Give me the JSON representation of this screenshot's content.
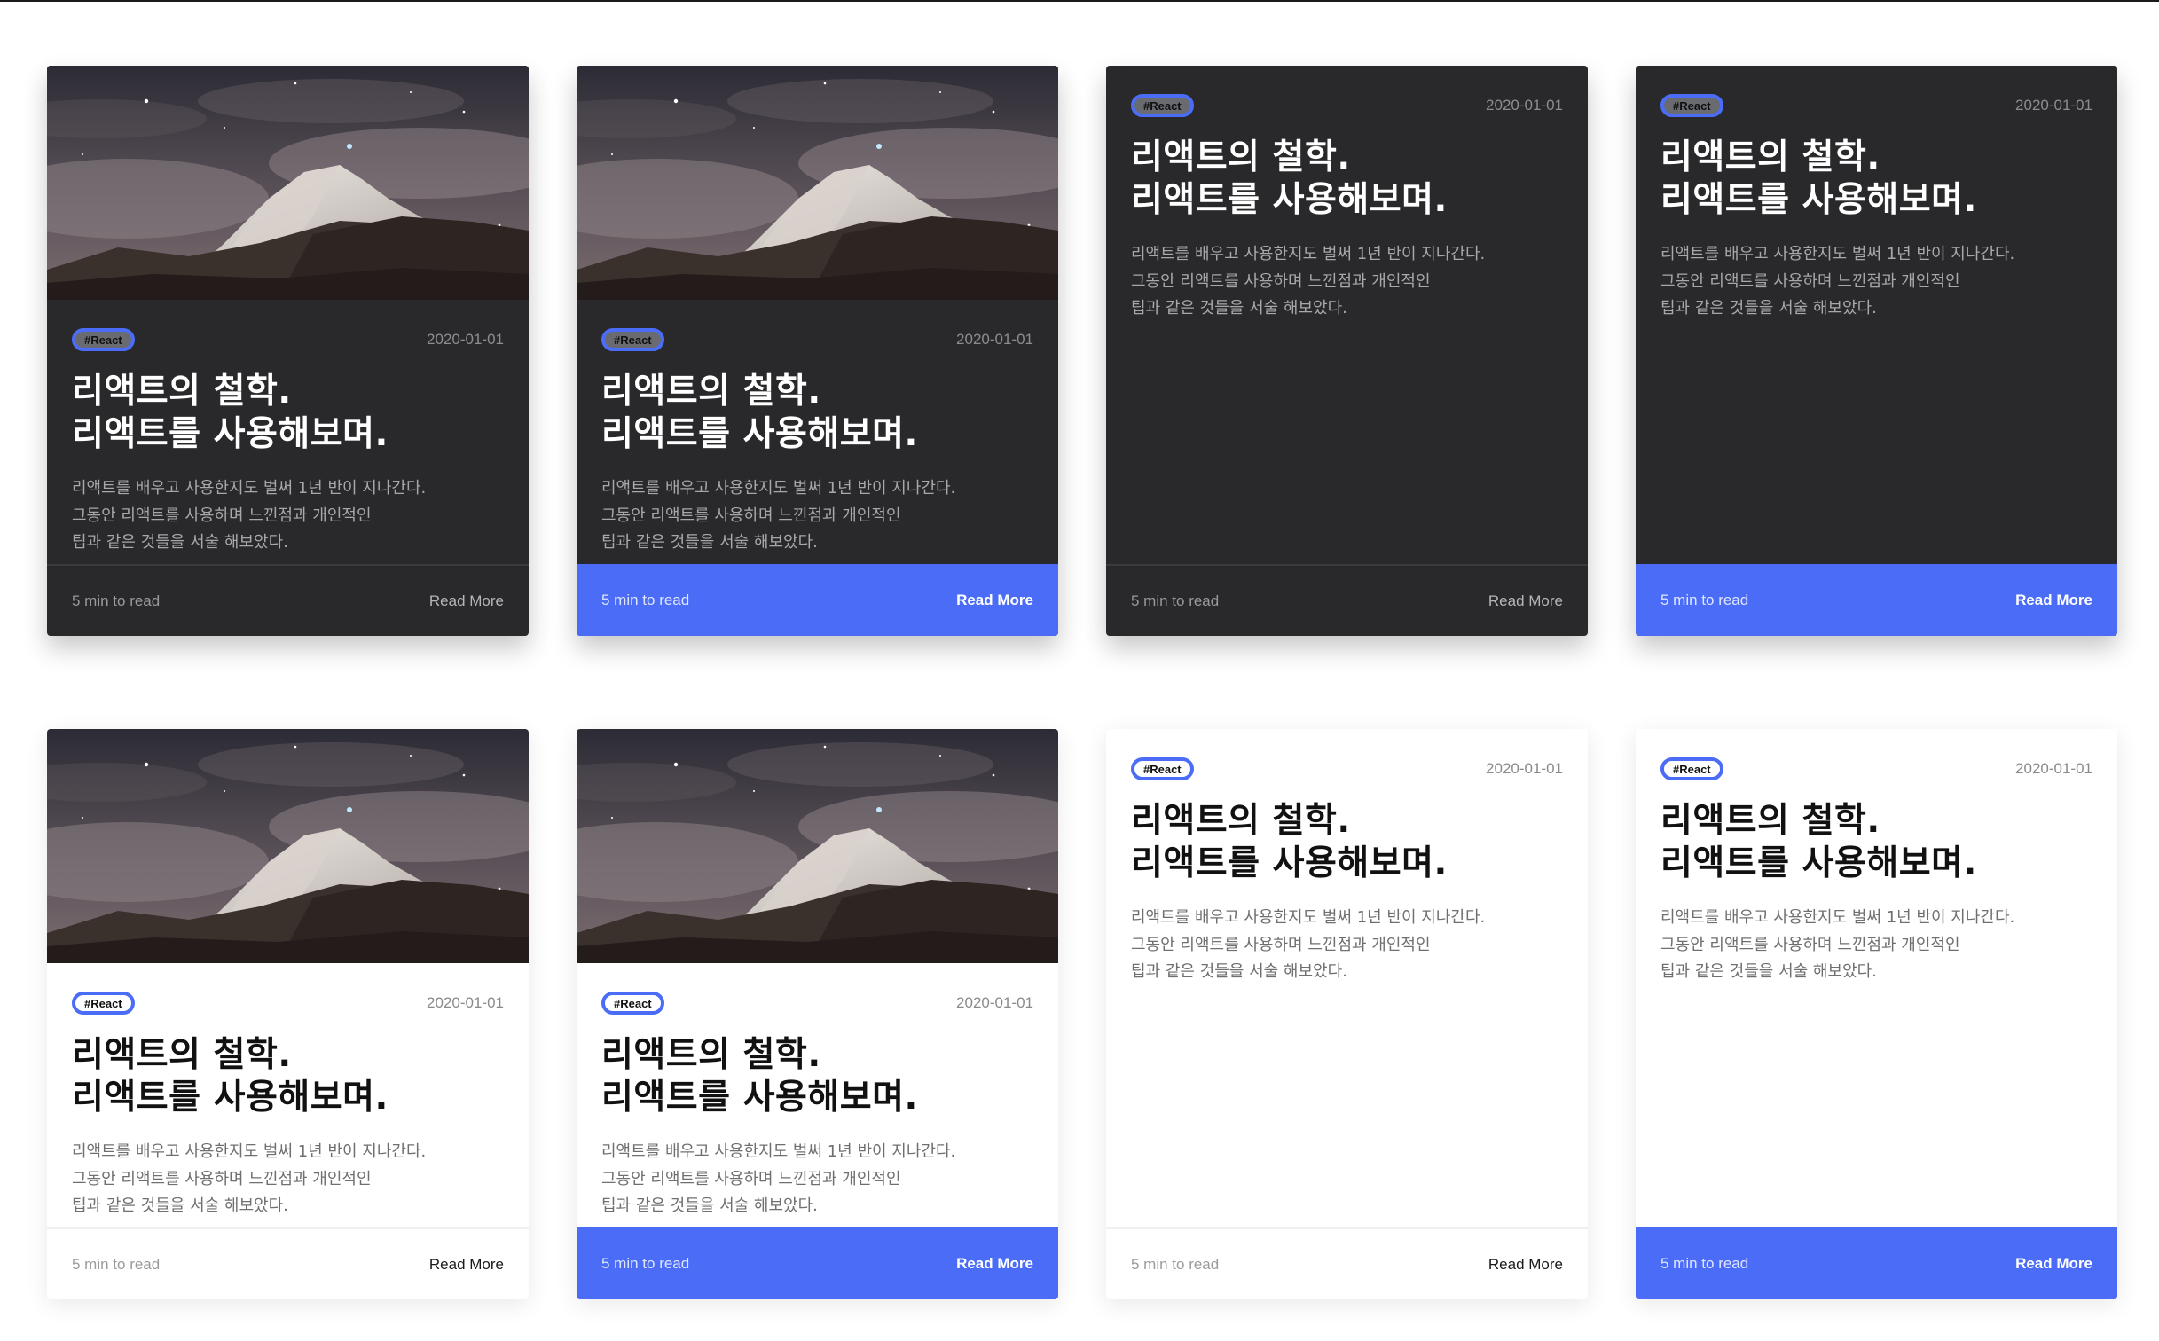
{
  "theme": {
    "accent": "#4a6cf7",
    "dark_card": "#29292b",
    "light_card": "#ffffff"
  },
  "cards": [
    {
      "variant": "dark",
      "image": true,
      "footer": "plain",
      "tag": "#React",
      "date": "2020-01-01",
      "title_line1": "리액트의 철학.",
      "title_line2": "리액트를 사용해보며.",
      "desc_line1": "리액트를 배우고 사용한지도 벌써 1년 반이 지나간다.",
      "desc_line2": "그동안 리액트를 사용하며 느낀점과 개인적인",
      "desc_line3": "팁과 같은 것들을 서술 해보았다.",
      "read_time": "5 min to read",
      "read_more": "Read More"
    },
    {
      "variant": "dark",
      "image": true,
      "footer": "accent",
      "tag": "#React",
      "date": "2020-01-01",
      "title_line1": "리액트의 철학.",
      "title_line2": "리액트를 사용해보며.",
      "desc_line1": "리액트를 배우고 사용한지도 벌써 1년 반이 지나간다.",
      "desc_line2": "그동안 리액트를 사용하며 느낀점과 개인적인",
      "desc_line3": "팁과 같은 것들을 서술 해보았다.",
      "read_time": "5 min to read",
      "read_more": "Read More"
    },
    {
      "variant": "dark",
      "image": false,
      "footer": "plain",
      "tag": "#React",
      "date": "2020-01-01",
      "title_line1": "리액트의 철학.",
      "title_line2": "리액트를 사용해보며.",
      "desc_line1": "리액트를 배우고 사용한지도 벌써 1년 반이 지나간다.",
      "desc_line2": "그동안 리액트를 사용하며 느낀점과 개인적인",
      "desc_line3": "팁과 같은 것들을 서술 해보았다.",
      "read_time": "5 min to read",
      "read_more": "Read More"
    },
    {
      "variant": "dark",
      "image": false,
      "footer": "accent",
      "tag": "#React",
      "date": "2020-01-01",
      "title_line1": "리액트의 철학.",
      "title_line2": "리액트를 사용해보며.",
      "desc_line1": "리액트를 배우고 사용한지도 벌써 1년 반이 지나간다.",
      "desc_line2": "그동안 리액트를 사용하며 느낀점과 개인적인",
      "desc_line3": "팁과 같은 것들을 서술 해보았다.",
      "read_time": "5 min to read",
      "read_more": "Read More"
    },
    {
      "variant": "light",
      "image": true,
      "footer": "plain",
      "tag": "#React",
      "date": "2020-01-01",
      "title_line1": "리액트의 철학.",
      "title_line2": "리액트를 사용해보며.",
      "desc_line1": "리액트를 배우고 사용한지도 벌써 1년 반이 지나간다.",
      "desc_line2": "그동안 리액트를 사용하며 느낀점과 개인적인",
      "desc_line3": "팁과 같은 것들을 서술 해보았다.",
      "read_time": "5 min to read",
      "read_more": "Read More"
    },
    {
      "variant": "light",
      "image": true,
      "footer": "accent",
      "tag": "#React",
      "date": "2020-01-01",
      "title_line1": "리액트의 철학.",
      "title_line2": "리액트를 사용해보며.",
      "desc_line1": "리액트를 배우고 사용한지도 벌써 1년 반이 지나간다.",
      "desc_line2": "그동안 리액트를 사용하며 느낀점과 개인적인",
      "desc_line3": "팁과 같은 것들을 서술 해보았다.",
      "read_time": "5 min to read",
      "read_more": "Read More"
    },
    {
      "variant": "light",
      "image": false,
      "footer": "plain",
      "tag": "#React",
      "date": "2020-01-01",
      "title_line1": "리액트의 철학.",
      "title_line2": "리액트를 사용해보며.",
      "desc_line1": "리액트를 배우고 사용한지도 벌써 1년 반이 지나간다.",
      "desc_line2": "그동안 리액트를 사용하며 느낀점과 개인적인",
      "desc_line3": "팁과 같은 것들을 서술 해보았다.",
      "read_time": "5 min to read",
      "read_more": "Read More"
    },
    {
      "variant": "light",
      "image": false,
      "footer": "accent",
      "tag": "#React",
      "date": "2020-01-01",
      "title_line1": "리액트의 철학.",
      "title_line2": "리액트를 사용해보며.",
      "desc_line1": "리액트를 배우고 사용한지도 벌써 1년 반이 지나간다.",
      "desc_line2": "그동안 리액트를 사용하며 느낀점과 개인적인",
      "desc_line3": "팁과 같은 것들을 서술 해보았다.",
      "read_time": "5 min to read",
      "read_more": "Read More"
    }
  ]
}
